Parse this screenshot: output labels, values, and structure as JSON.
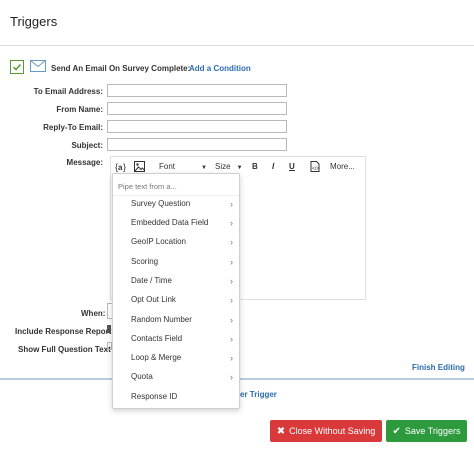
{
  "title": "Triggers",
  "trigger": {
    "label": "Send An Email On Survey Complete:",
    "add_condition": "Add a Condition"
  },
  "fields": [
    {
      "label": "To Email Address:",
      "value": ""
    },
    {
      "label": "From Name:",
      "value": ""
    },
    {
      "label": "Reply-To Email:",
      "value": ""
    },
    {
      "label": "Subject:",
      "value": ""
    }
  ],
  "message_label": "Message:",
  "toolbar": {
    "piped_icon": "piped-text-icon",
    "image_icon": "image-icon",
    "font": "Font",
    "size": "Size",
    "bold": "B",
    "italic": "I",
    "underline": "U",
    "source_icon": "source-code-icon",
    "more": "More..."
  },
  "piped_menu": {
    "placeholder": "Pipe text from a...",
    "items": [
      "Survey Question",
      "Embedded Data Field",
      "GeoIP Location",
      "Scoring",
      "Date / Time",
      "Opt Out Link",
      "Random Number",
      "Contacts Field",
      "Loop & Merge",
      "Quota",
      "Response ID"
    ]
  },
  "lower": {
    "when": "When:",
    "include_report": "Include Response Report",
    "show_full": "Show Full Question Text"
  },
  "finish_editing": "Finish Editing",
  "partial_link": "er Trigger",
  "buttons": {
    "close": "Close Without Saving",
    "save": "Save Triggers"
  },
  "colors": {
    "link": "#2b6cb0",
    "close_button": "#d9393a",
    "save_button": "#2e9a3e",
    "checkbox": "#5a9a33"
  }
}
